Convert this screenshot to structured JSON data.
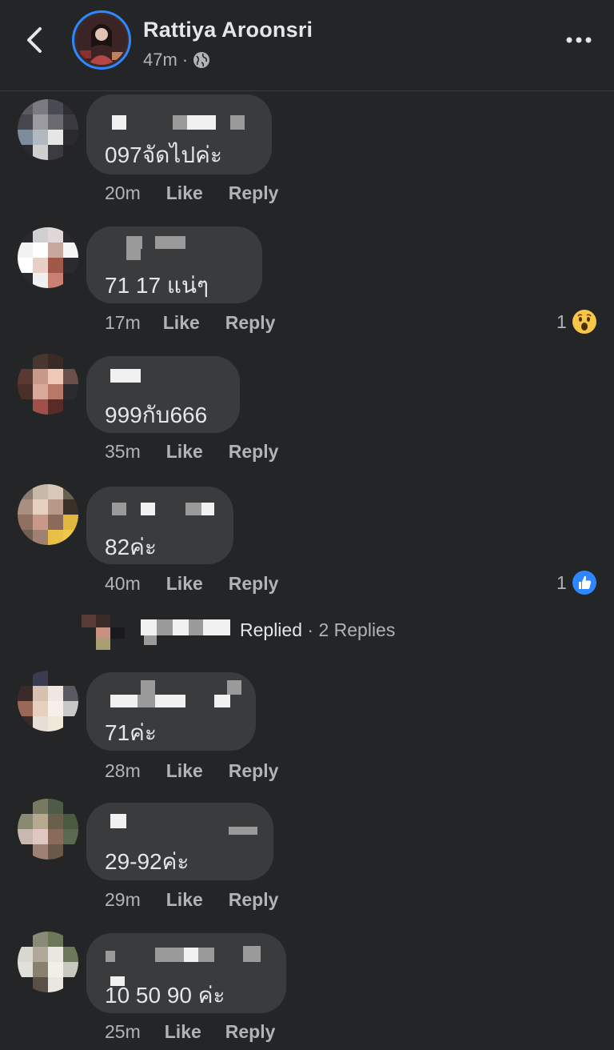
{
  "header": {
    "name": "Rattiya Aroonsri",
    "time": "47m",
    "separator": "·"
  },
  "comments": [
    {
      "text": "097จัดไปค่ะ",
      "time": "20m",
      "like": "Like",
      "reply": "Reply"
    },
    {
      "text": "71 17 แน่ๆ",
      "time": "17m",
      "like": "Like",
      "reply": "Reply",
      "reaction_count": "1",
      "reaction": "wow"
    },
    {
      "text": "999กับ666",
      "time": "35m",
      "like": "Like",
      "reply": "Reply"
    },
    {
      "text": "82ค่ะ",
      "time": "40m",
      "like": "Like",
      "reply": "Reply",
      "reaction_count": "1",
      "reaction": "like"
    },
    {
      "text": "71ค่ะ",
      "time": "28m",
      "like": "Like",
      "reply": "Reply"
    },
    {
      "text": "29-92ค่ะ",
      "time": "29m",
      "like": "Like",
      "reply": "Reply"
    },
    {
      "text": "10 50 90 ค่ะ",
      "time": "25m",
      "like": "Like",
      "reply": "Reply"
    }
  ],
  "replies_summary": {
    "label": "Replied",
    "separator": " · ",
    "count_label": "2 Replies"
  },
  "colors": {
    "background": "#242526",
    "bubble": "#3a3b3c",
    "text": "#e4e6eb",
    "muted": "#b0b3b8",
    "like_blue": "#2d88ff",
    "wow_yellow": "#f7c74a"
  },
  "icons": [
    "chevron-left-icon",
    "globe-icon",
    "more-icon",
    "wow-reaction-icon",
    "like-reaction-icon"
  ]
}
